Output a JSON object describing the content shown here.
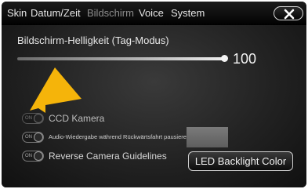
{
  "tabs": [
    {
      "label": "Skin",
      "active": false
    },
    {
      "label": "Datum/Zeit",
      "active": false
    },
    {
      "label": "Bildschirm",
      "active": true
    },
    {
      "label": "Voice",
      "active": false
    },
    {
      "label": "System",
      "active": false
    }
  ],
  "close_icon": "close-x-icon",
  "brightness": {
    "label": "Bildschirm-Helligkeit (Tag-Modus)",
    "value": "100",
    "level_fraction": 1.0
  },
  "options": [
    {
      "toggle_text": "ON",
      "label": "CCD Kamera",
      "state": "on"
    },
    {
      "toggle_text": "ON",
      "label": "Audio-Wiedergabe während Rückwärtsfahrt pausieren",
      "state": "on"
    },
    {
      "toggle_text": "ON",
      "label": "Reverse Camera Guidelines",
      "state": "on"
    }
  ],
  "led": {
    "button_label": "LED Backlight Color",
    "swatch_color": "#6e6e6e"
  },
  "annotation": {
    "arrow_color": "#f5b40a",
    "icon": "pointer-arrow-icon"
  },
  "colors": {
    "accent": "#f5b40a",
    "background": "#000000",
    "text": "#e8e8e8"
  }
}
